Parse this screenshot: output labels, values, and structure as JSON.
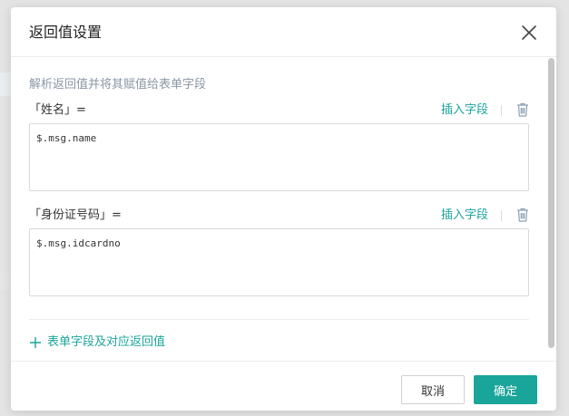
{
  "dialog": {
    "title": "返回值设置",
    "hint": "解析返回值并将其赋值给表单字段",
    "fields": [
      {
        "label": "「姓名」=",
        "insert_label": "插入字段",
        "value": "$.msg.name"
      },
      {
        "label": "「身份证号码」=",
        "insert_label": "插入字段",
        "value": "$.msg.idcardno"
      }
    ],
    "add_label": "表单字段及对应返回值",
    "cancel_label": "取消",
    "ok_label": "确定"
  },
  "colors": {
    "accent": "#1aa59a",
    "hint_text": "#8a97a5",
    "border": "#d9d9d9"
  },
  "icons": {
    "close": "close-icon",
    "delete": "trash-icon",
    "add": "plus-icon"
  }
}
